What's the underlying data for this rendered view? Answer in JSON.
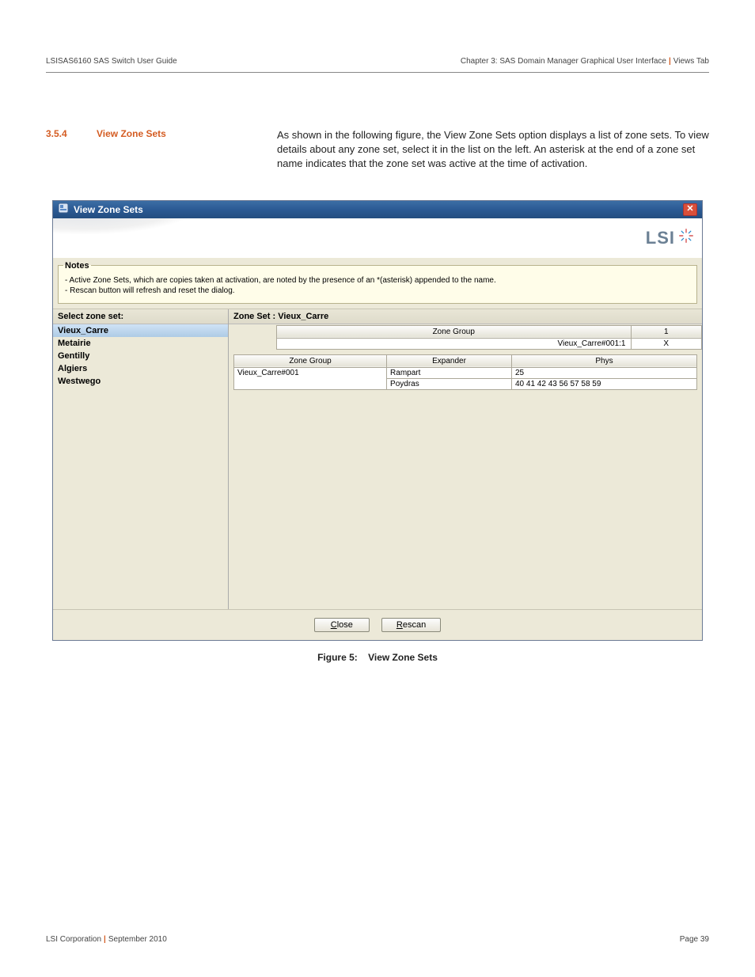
{
  "header": {
    "left": "LSISAS6160 SAS Switch User Guide",
    "right_prefix": "Chapter 3: SAS Domain Manager Graphical User Interface",
    "right_suffix": "Views Tab"
  },
  "section": {
    "number": "3.5.4",
    "title": "View Zone Sets",
    "body": "As shown in the following figure, the View Zone Sets option displays a list of zone sets. To view details about any zone set, select it in the list on the left. An asterisk at the end of a zone set name indicates that the zone set was active at the time of activation."
  },
  "dialog": {
    "title": "View Zone Sets",
    "logo": "LSI",
    "notes_legend": "Notes",
    "note1": "- Active Zone Sets, which are copies taken at activation, are noted by the presence of an *(asterisk) appended to the name.",
    "note2": "- Rescan button will refresh and reset the dialog.",
    "select_label": "Select zone set:",
    "zone_sets": [
      "Vieux_Carre",
      "Metairie",
      "Gentilly",
      "Algiers",
      "Westwego"
    ],
    "detail_title": "Zone Set : Vieux_Carre",
    "mini_headers": [
      "Zone Group",
      "1"
    ],
    "mini_row": [
      "Vieux_Carre#001:1",
      "X"
    ],
    "wide_headers": [
      "Zone Group",
      "Expander",
      "Phys"
    ],
    "wide_rows": [
      [
        "Vieux_Carre#001",
        "Rampart",
        "25"
      ],
      [
        "",
        "Poydras",
        "40 41 42 43 56 57 58 59"
      ]
    ],
    "close_label": "Close",
    "rescan_label": "Rescan"
  },
  "figure": {
    "label": "Figure 5:",
    "caption": "View Zone Sets"
  },
  "footer": {
    "left_company": "LSI Corporation",
    "left_date": "September 2010",
    "right": "Page 39"
  }
}
